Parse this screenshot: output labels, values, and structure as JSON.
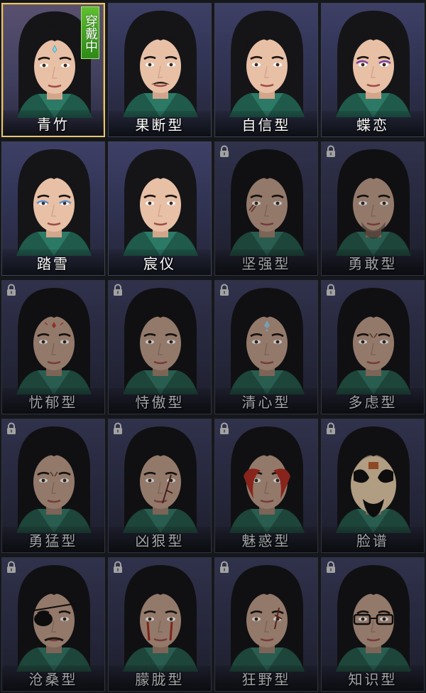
{
  "colors": {
    "selected_border": "#e6c476",
    "badge_green": "#3fa31f",
    "label_text": "#ffffff"
  },
  "cards": [
    {
      "label": "青竹",
      "locked": false,
      "selected": true,
      "badge": "穿戴中",
      "makeup": "forehead-gem"
    },
    {
      "label": "果断型",
      "locked": false,
      "selected": false,
      "makeup": "mustache"
    },
    {
      "label": "自信型",
      "locked": false,
      "selected": false,
      "makeup": "none"
    },
    {
      "label": "蝶恋",
      "locked": false,
      "selected": false,
      "makeup": "purple-eyes"
    },
    {
      "label": "踏雪",
      "locked": false,
      "selected": false,
      "makeup": "blue-eyes"
    },
    {
      "label": "宸仪",
      "locked": false,
      "selected": false,
      "makeup": "none"
    },
    {
      "label": "坚强型",
      "locked": true,
      "selected": false,
      "makeup": "cheek-scar"
    },
    {
      "label": "勇敢型",
      "locked": true,
      "selected": false,
      "makeup": "stubble"
    },
    {
      "label": "忧郁型",
      "locked": true,
      "selected": false,
      "makeup": "forehead-red-mark"
    },
    {
      "label": "恃傲型",
      "locked": true,
      "selected": false,
      "makeup": "none"
    },
    {
      "label": "清心型",
      "locked": true,
      "selected": false,
      "makeup": "forehead-blue-mark"
    },
    {
      "label": "多虑型",
      "locked": true,
      "selected": false,
      "makeup": "frown"
    },
    {
      "label": "勇猛型",
      "locked": true,
      "selected": false,
      "makeup": "frown"
    },
    {
      "label": "凶狠型",
      "locked": true,
      "selected": false,
      "makeup": "face-scar"
    },
    {
      "label": "魅惑型",
      "locked": true,
      "selected": false,
      "makeup": "red-paint"
    },
    {
      "label": "脸谱",
      "locked": true,
      "selected": false,
      "makeup": "opera-mask"
    },
    {
      "label": "沧桑型",
      "locked": true,
      "selected": false,
      "makeup": "eyepatch"
    },
    {
      "label": "朦胧型",
      "locked": true,
      "selected": false,
      "makeup": "red-tears"
    },
    {
      "label": "狂野型",
      "locked": true,
      "selected": false,
      "makeup": "eye-scar"
    },
    {
      "label": "知识型",
      "locked": true,
      "selected": false,
      "makeup": "glasses"
    }
  ]
}
